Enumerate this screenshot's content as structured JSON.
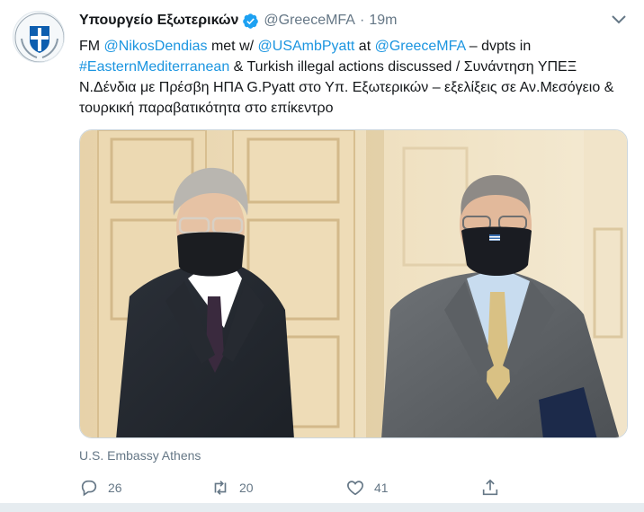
{
  "account": {
    "display_name": "Υπουργείο Εξωτερικών",
    "handle": "@GreeceMFA",
    "separator": "·",
    "time": "19m",
    "verified": true
  },
  "tweet": {
    "segments": [
      {
        "text": "FM ",
        "link": false
      },
      {
        "text": "@NikosDendias",
        "link": true
      },
      {
        "text": " met w/ ",
        "link": false
      },
      {
        "text": "@USAmbPyatt",
        "link": true
      },
      {
        "text": " at ",
        "link": false
      },
      {
        "text": "@GreeceMFA",
        "link": true
      },
      {
        "text": " – dvpts in ",
        "link": false
      },
      {
        "text": "#EasternMediterranean",
        "link": true
      },
      {
        "text": " & Turkish illegal actions discussed / Συνάντηση ΥΠΕΞ Ν.Δένδια με Πρέσβη ΗΠΑ G.Pyatt στο Υπ. Εξωτερικών – εξελίξεις σε Αν.Μεσόγειο & τουρκική παραβατικότητα στο επίκεντρο",
        "link": false
      }
    ],
    "media_credit": "U.S. Embassy Athens"
  },
  "actions": {
    "reply_count": "26",
    "retweet_count": "20",
    "like_count": "41"
  },
  "icons": {
    "avatar": "greek-coat-of-arms-icon",
    "verified": "verified-badge-icon",
    "caret": "chevron-down-icon",
    "reply": "reply-icon",
    "retweet": "retweet-icon",
    "like": "heart-icon",
    "share": "share-icon"
  },
  "colors": {
    "link": "#1b95e0",
    "text": "#14171a",
    "muted": "#657786",
    "verified": "#1da1f2",
    "avatar_blue": "#0d5eaf"
  }
}
